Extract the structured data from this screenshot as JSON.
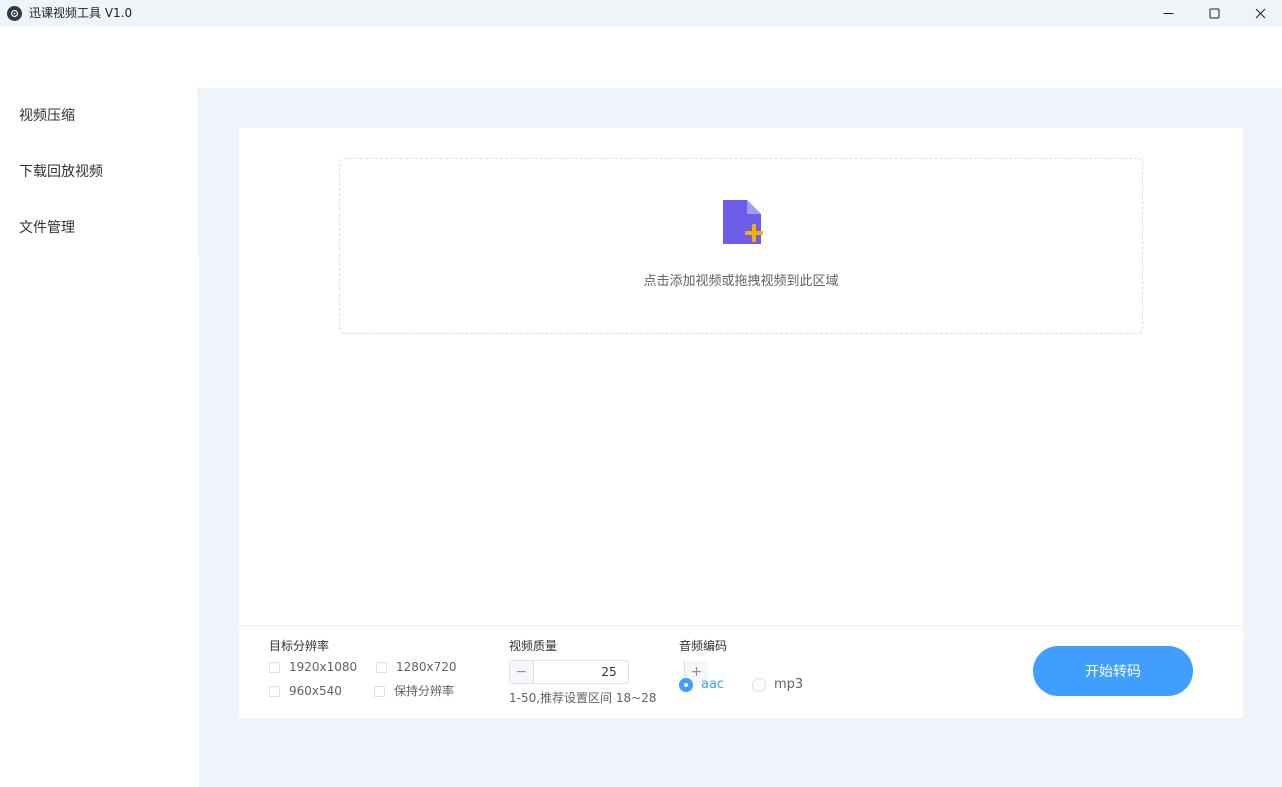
{
  "window": {
    "title": "迅课视频工具 V1.0",
    "icon": "app-logo-icon",
    "controls": [
      "minimize-icon",
      "maximize-icon",
      "close-icon"
    ]
  },
  "sidebar": {
    "items": [
      {
        "label": "视频压缩"
      },
      {
        "label": "下载回放视频"
      },
      {
        "label": "文件管理"
      }
    ]
  },
  "dropzone": {
    "icon": "add-file-icon",
    "text": "点击添加视频或拖拽视频到此区域"
  },
  "resolution": {
    "label": "目标分辨率",
    "options": [
      {
        "label": "1920x1080",
        "checked": false
      },
      {
        "label": "1280x720",
        "checked": false
      },
      {
        "label": "960x540",
        "checked": false
      },
      {
        "label": "保持分辨率",
        "checked": false
      }
    ]
  },
  "quality": {
    "label": "视频质量",
    "value": "25",
    "minus": "−",
    "plus": "+",
    "hint": "1-50,推荐设置区间 18~28"
  },
  "audio": {
    "label": "音频编码",
    "options": [
      {
        "label": "aac",
        "selected": true
      },
      {
        "label": "mp3",
        "selected": false
      }
    ]
  },
  "actions": {
    "start_label": "开始转码"
  },
  "colors": {
    "accent": "#409eff",
    "main_bg": "#eff3fa",
    "titlebar_bg": "#eff4f9",
    "icon_purple": "#6c5ce7",
    "icon_plus": "#f6b100"
  }
}
